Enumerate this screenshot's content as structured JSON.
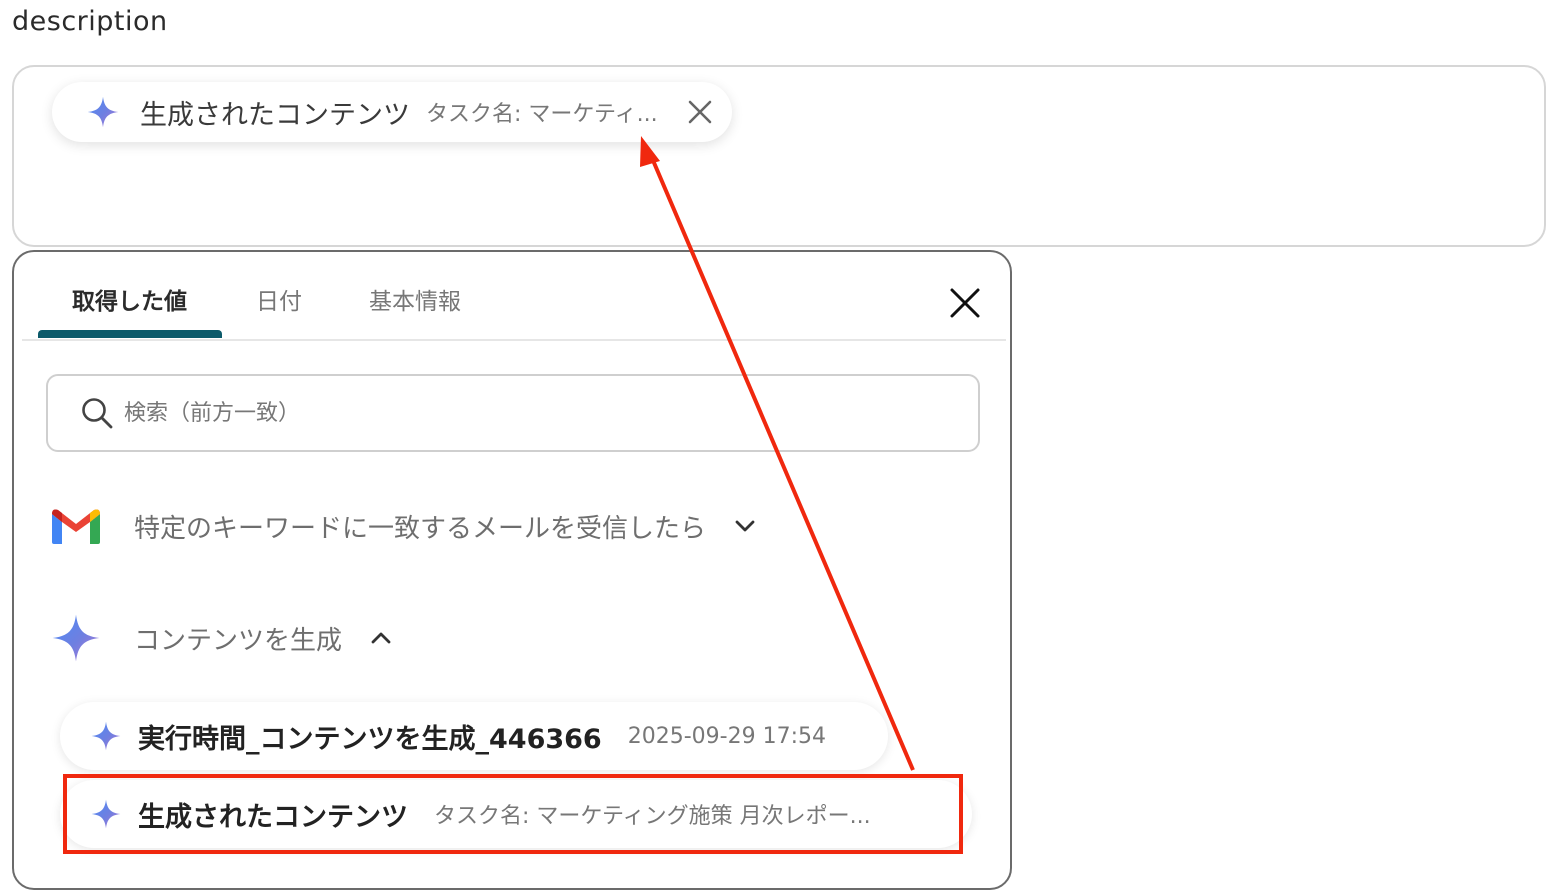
{
  "field": {
    "label": "description"
  },
  "chip": {
    "title": "生成されたコンテンツ",
    "subtitle": "タスク名: マーケティ..."
  },
  "popup": {
    "tabs": [
      {
        "label": "取得した値",
        "active": true
      },
      {
        "label": "日付",
        "active": false
      },
      {
        "label": "基本情報",
        "active": false
      }
    ],
    "search": {
      "placeholder": "検索（前方一致）"
    },
    "groups": [
      {
        "title": "特定のキーワードに一致するメールを受信したら",
        "expanded": false
      },
      {
        "title": "コンテンツを生成",
        "expanded": true
      }
    ],
    "items": [
      {
        "title": "実行時間_コンテンツを生成_446366",
        "value": "2025-09-29 17:54"
      },
      {
        "title": "生成されたコンテンツ",
        "value": "タスク名: マーケティング施策 月次レポー..."
      }
    ]
  },
  "colors": {
    "accent_tab": "#0c5a6a",
    "annotation": "#f0280e",
    "gmail_red": "#ea4335",
    "gmail_blue": "#4285f4",
    "gmail_green": "#34a853",
    "gmail_yellow": "#fbbc04"
  },
  "icons": {
    "spark": "gemini-spark-icon",
    "close": "close-icon",
    "search": "search-icon",
    "gmail": "gmail-icon",
    "chevron_down": "chevron-down-icon",
    "chevron_up": "chevron-up-icon"
  }
}
